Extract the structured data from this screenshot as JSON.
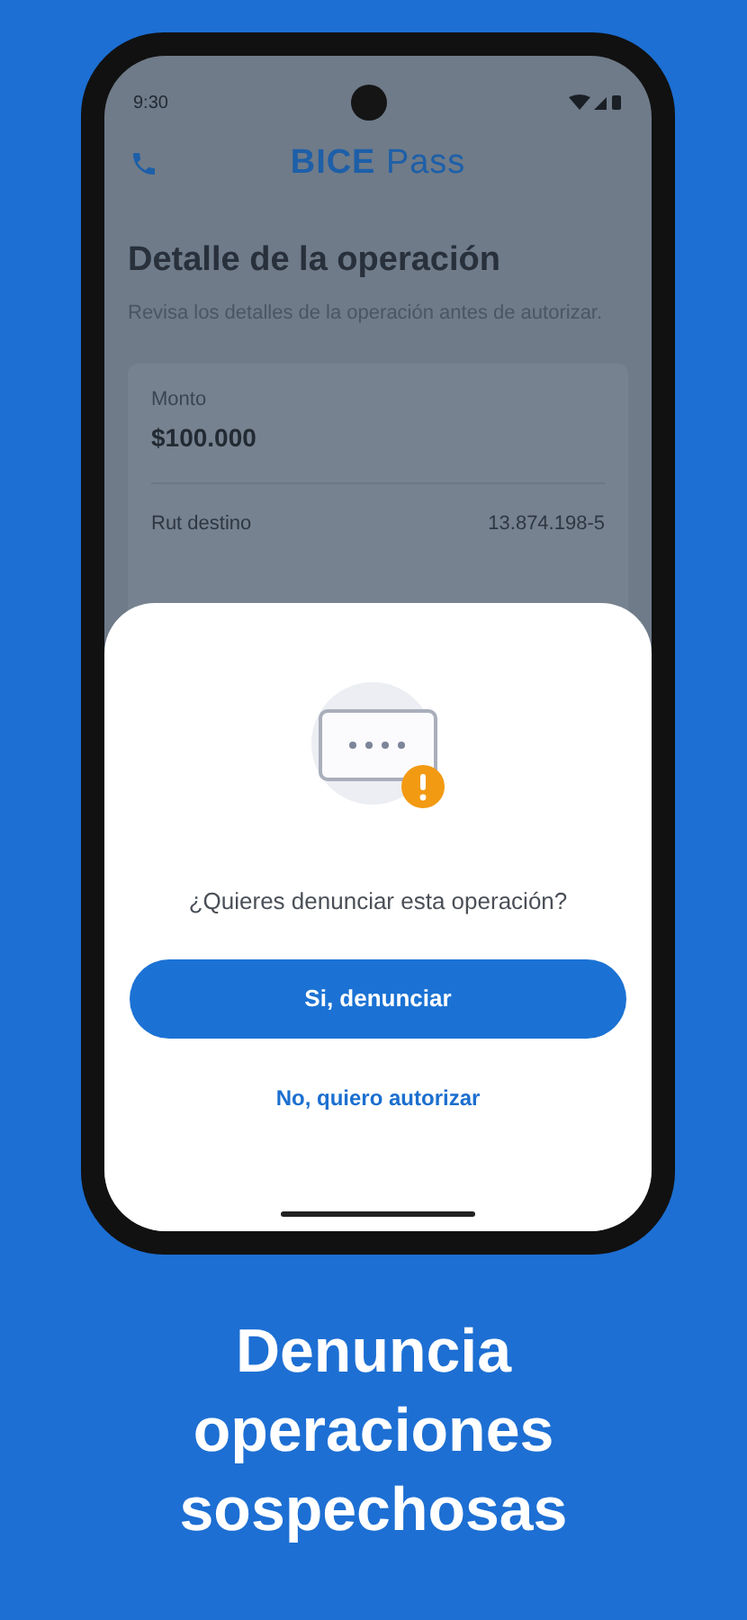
{
  "status_bar": {
    "time": "9:30"
  },
  "header": {
    "brand_bold": "BICE",
    "brand_light": "Pass"
  },
  "detail": {
    "title": "Detalle de la operación",
    "subtitle": "Revisa los detalles de la operación antes de autorizar.",
    "amount": {
      "label": "Monto",
      "value": "$100.000"
    },
    "rows": [
      {
        "label": "Rut destino",
        "value": "13.874.198-5"
      }
    ]
  },
  "sheet": {
    "question": "¿Quieres denunciar esta operación?",
    "primary_button": "Si, denunciar",
    "secondary_link": "No, quiero autorizar"
  },
  "headline": "Denuncia operaciones sospechosas"
}
